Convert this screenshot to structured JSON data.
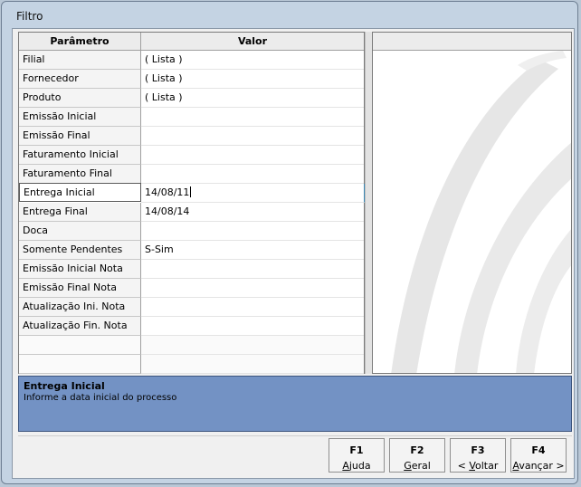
{
  "window": {
    "title": "Filtro"
  },
  "grid": {
    "header": {
      "param": "Parâmetro",
      "value": "Valor"
    },
    "rows": [
      {
        "param": "Filial",
        "value": "( Lista )"
      },
      {
        "param": "Fornecedor",
        "value": "( Lista )"
      },
      {
        "param": "Produto",
        "value": "( Lista )"
      },
      {
        "param": "Emissão Inicial",
        "value": ""
      },
      {
        "param": "Emissão Final",
        "value": ""
      },
      {
        "param": "Faturamento Inicial",
        "value": ""
      },
      {
        "param": "Faturamento Final",
        "value": ""
      },
      {
        "param": "Entrega Inicial",
        "value": "14/08/11"
      },
      {
        "param": "Entrega Final",
        "value": "14/08/14"
      },
      {
        "param": "Doca",
        "value": ""
      },
      {
        "param": "Somente Pendentes",
        "value": "S-Sim"
      },
      {
        "param": "Emissão Inicial Nota",
        "value": ""
      },
      {
        "param": "Emissão Final Nota",
        "value": ""
      },
      {
        "param": "Atualização Ini. Nota",
        "value": ""
      },
      {
        "param": "Atualização Fin. Nota",
        "value": ""
      }
    ],
    "active_row": "Entrega Inicial"
  },
  "help": {
    "title": "Entrega Inicial",
    "text": "Informe a data inicial do processo"
  },
  "buttons": [
    {
      "key": "F1",
      "label": "Ajuda",
      "underline": "A"
    },
    {
      "key": "F2",
      "label": "Geral",
      "underline": "G"
    },
    {
      "key": "F3",
      "label": "< Voltar",
      "underline": "V"
    },
    {
      "key": "F4",
      "label": "Avançar >",
      "underline": "A"
    }
  ],
  "colors": {
    "help_bg": "#7392c4",
    "window_frame": "#c4d3e3"
  }
}
